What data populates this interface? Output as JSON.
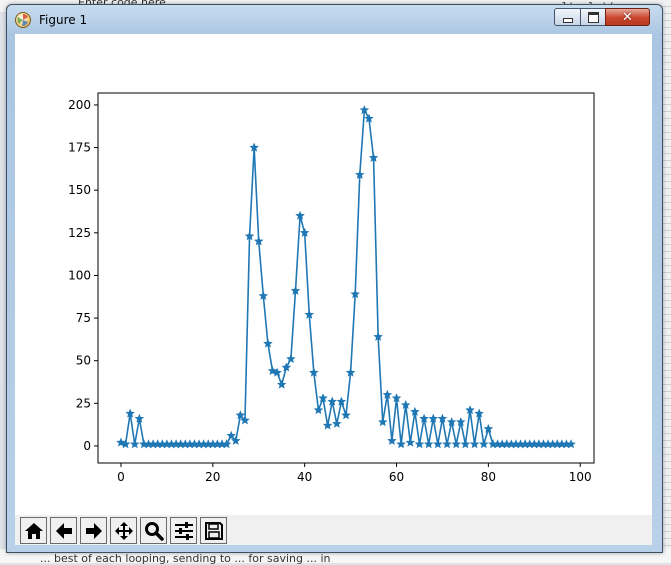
{
  "background": {
    "top_text": "Enter code here",
    "right_text": "plt.plot(",
    "bottom_text": "... best of each looping, sending to ... for saving ... in"
  },
  "window": {
    "title": "Figure 1",
    "minimize_icon": "minimize-icon",
    "maximize_icon": "maximize-icon",
    "close_glyph": "✕"
  },
  "toolbar": {
    "buttons": [
      {
        "name": "home-button",
        "icon": "home-icon"
      },
      {
        "name": "back-button",
        "icon": "arrow-left-icon"
      },
      {
        "name": "forward-button",
        "icon": "arrow-right-icon"
      },
      {
        "name": "pan-button",
        "icon": "move-icon"
      },
      {
        "name": "zoom-button",
        "icon": "magnifier-icon"
      },
      {
        "name": "configure-subplots-button",
        "icon": "sliders-icon"
      },
      {
        "name": "save-button",
        "icon": "floppy-disk-icon"
      }
    ]
  },
  "colors": {
    "line": "#1f77b4"
  },
  "chart_data": {
    "type": "line",
    "marker": "star",
    "xlim": [
      -5,
      103
    ],
    "ylim": [
      -10,
      207
    ],
    "xticks": [
      0,
      20,
      40,
      60,
      80,
      100
    ],
    "yticks": [
      0,
      25,
      50,
      75,
      100,
      125,
      150,
      175,
      200
    ],
    "grid": false,
    "series": [
      {
        "x": [
          0,
          1,
          2,
          3,
          4,
          5,
          6,
          7,
          8,
          9,
          10,
          11,
          12,
          13,
          14,
          15,
          16,
          17,
          18,
          19,
          20,
          21,
          22,
          23,
          24,
          25,
          26,
          27,
          28,
          29,
          30,
          31,
          32,
          33,
          34,
          35,
          36,
          37,
          38,
          39,
          40,
          41,
          42,
          43,
          44,
          45,
          46,
          47,
          48,
          49,
          50,
          51,
          52,
          53,
          54,
          55,
          56,
          57,
          58,
          59,
          60,
          61,
          62,
          63,
          64,
          65,
          66,
          67,
          68,
          69,
          70,
          71,
          72,
          73,
          74,
          75,
          76,
          77,
          78,
          79,
          80,
          81,
          82,
          83,
          84,
          85,
          86,
          87,
          88,
          89,
          90,
          91,
          92,
          93,
          94,
          95,
          96,
          97,
          98
        ],
        "y": [
          2,
          1,
          19,
          1,
          16,
          1,
          1,
          1,
          1,
          1,
          1,
          1,
          1,
          1,
          1,
          1,
          1,
          1,
          1,
          1,
          1,
          1,
          1,
          1,
          6,
          3,
          18,
          15,
          123,
          175,
          120,
          88,
          60,
          44,
          43,
          36,
          46,
          51,
          91,
          135,
          125,
          77,
          43,
          21,
          28,
          12,
          26,
          13,
          26,
          18,
          43,
          89,
          159,
          197,
          192,
          169,
          64,
          14,
          30,
          3,
          28,
          1,
          24,
          2,
          20,
          1,
          16,
          1,
          16,
          1,
          16,
          1,
          14,
          1,
          14,
          1,
          21,
          1,
          19,
          1,
          10,
          1,
          1,
          1,
          1,
          1,
          1,
          1,
          1,
          1,
          1,
          1,
          1,
          1,
          1,
          1,
          1,
          1,
          1
        ]
      }
    ]
  }
}
